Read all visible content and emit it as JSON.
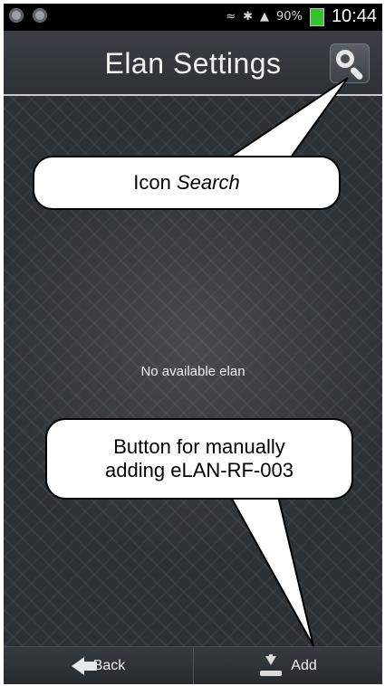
{
  "statusbar": {
    "battery": "90%",
    "time": "10:44"
  },
  "header": {
    "title": "Elan Settings",
    "search_icon": "search-icon"
  },
  "content": {
    "empty_message": "No available elan"
  },
  "footer": {
    "back_label": "Back",
    "add_label": "Add"
  },
  "annotations": {
    "search_prefix": "Icon ",
    "search_italic": "Search",
    "add_line1": "Button for manually",
    "add_line2": "adding eLAN-RF-003"
  }
}
